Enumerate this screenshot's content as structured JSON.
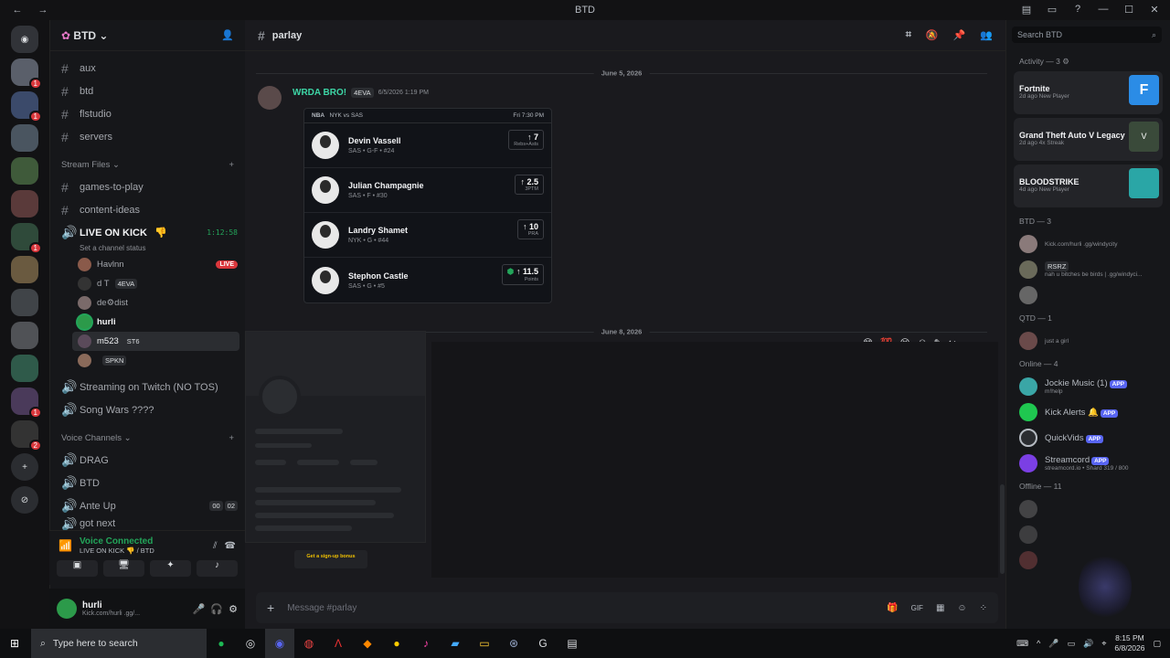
{
  "titlebar": {
    "title": "BTD"
  },
  "server": {
    "name": "BTD"
  },
  "channels": {
    "top": [
      "aux",
      "btd",
      "flstudio",
      "servers"
    ],
    "stream_category": "Stream Files",
    "stream": [
      "games-to-play",
      "content-ideas"
    ],
    "live": {
      "name": "LIVE ON KICK",
      "emoji": "👎",
      "timer": "1:12:58",
      "status": "Set a channel status"
    },
    "voice_users": [
      {
        "name": "Havlnn",
        "tag": "",
        "live": "LIVE"
      },
      {
        "name": "d T",
        "tag": "4EVA",
        "live": ""
      },
      {
        "name": "de⚙dist",
        "tag": "",
        "live": ""
      },
      {
        "name": "hurli",
        "tag": "",
        "live": ""
      },
      {
        "name": "m523",
        "tag": "ST6",
        "live": ""
      },
      {
        "name": "",
        "tag": "SPKN",
        "live": ""
      }
    ],
    "more": [
      "Streaming on Twitch (NO TOS)",
      "Song Wars ????"
    ],
    "voice_category": "Voice Channels",
    "voice": [
      "DRAG",
      "BTD",
      "Ante Up",
      "got next"
    ],
    "ante_counts": [
      "00",
      "02"
    ]
  },
  "voice_connected": {
    "status": "Voice Connected",
    "where": "LIVE ON KICK 👎 / BTD"
  },
  "user": {
    "name": "hurli",
    "status": "Kick.com/hurli .gg/..."
  },
  "channel": {
    "name": "parlay"
  },
  "search": {
    "placeholder": "Search BTD"
  },
  "messages": {
    "date1": "June 5, 2026",
    "author": "WRDA BRO!",
    "author_tag": "4EVA",
    "timestamp": "6/5/2026 1:19 PM",
    "card": {
      "league": "NBA",
      "matchup": "NYK vs SAS",
      "time": "Fri 7:30 PM",
      "players": [
        {
          "name": "Devin Vassell",
          "info": "SAS • G-F • #24",
          "value": "7",
          "stat": "Rebs+Asts"
        },
        {
          "name": "Julian Champagnie",
          "info": "SAS • F • #30",
          "value": "2.5",
          "stat": "3PTM"
        },
        {
          "name": "Landry Shamet",
          "info": "NYK • G • #44",
          "value": "10",
          "stat": "PRA"
        },
        {
          "name": "Stephon Castle",
          "info": "SAS • G • #5",
          "value": "11.5",
          "stat": "Points"
        }
      ]
    },
    "date2": "June 8, 2026",
    "promo": "Get a sign-up bonus"
  },
  "compose": {
    "placeholder": "Message #parlay"
  },
  "members": {
    "activity_header": "Activity — 3",
    "activities": [
      {
        "title": "Fortnite",
        "sub": "2d ago  New Player",
        "color": "#2b8ce6"
      },
      {
        "title": "Grand Theft Auto V Legacy",
        "sub": "2d ago  4x Streak",
        "color": "#3a4a3a"
      },
      {
        "title": "BLOODSTRIKE",
        "sub": "4d ago  New Player",
        "color": "#2aa6a6"
      }
    ],
    "btd_header": "BTD — 3",
    "btd": [
      {
        "name": "",
        "sub": "Kick.com/hurli .gg/windycity"
      },
      {
        "name": "RSRZ",
        "sub": "nah u bitches be birds | .gg/windyci..."
      },
      {
        "name": "",
        "sub": ""
      }
    ],
    "qtd_header": "QTD — 1",
    "qtd": [
      {
        "name": "",
        "sub": "just a girl"
      }
    ],
    "online_header": "Online — 4",
    "online": [
      {
        "name": "Jockie Music (1)",
        "sub": "m!help",
        "badge": "APP"
      },
      {
        "name": "Kick Alerts 🔔",
        "sub": "",
        "badge": "APP"
      },
      {
        "name": "QuickVids",
        "sub": "",
        "badge": "APP"
      },
      {
        "name": "Streamcord",
        "sub": "streamcord.io • Shard 319 / 800",
        "badge": "APP"
      }
    ],
    "offline_header": "Offline — 11"
  },
  "taskbar": {
    "search": "Type here to search",
    "time": "8:15 PM",
    "date": "6/8/2026"
  }
}
